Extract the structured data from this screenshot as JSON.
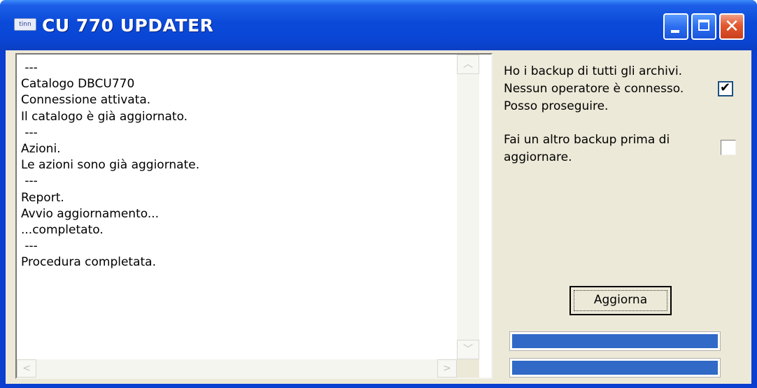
{
  "window": {
    "title": "CU 770 UPDATER",
    "icon_label": "tinn",
    "close_glyph": "✕"
  },
  "log": {
    "lines": [
      " ---",
      "Catalogo DBCU770",
      "Connessione attivata.",
      "Il catalogo è già aggiornato.",
      " ---",
      "Azioni.",
      "Le azioni sono già aggiornate.",
      " ---",
      "Report.",
      "Avvio aggiornamento...",
      "...completato.",
      " ---",
      "Procedura completata."
    ],
    "scroll_up": "︿",
    "scroll_down": "﹀",
    "scroll_left": "<",
    "scroll_right": ">"
  },
  "options": {
    "backup_ok": {
      "label": "Ho i backup di tutti gli archivi.\nNessun operatore è connesso.\nPosso proseguire.",
      "checked": true,
      "check_glyph": "✔"
    },
    "extra_backup": {
      "label": "Fai un altro backup prima di\naggiornare.",
      "checked": false
    }
  },
  "actions": {
    "update_label": "Aggiorna"
  },
  "progress": {
    "bar1": 1.0,
    "bar2": 1.0
  },
  "colors": {
    "titlebar": "#0a46d6",
    "client_bg": "#ece9d8",
    "progress_fill": "#3169c6",
    "close_button": "#e2582f"
  }
}
